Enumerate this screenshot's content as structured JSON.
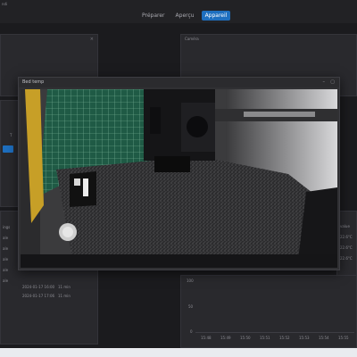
{
  "app": {
    "title": "ndi"
  },
  "nav": {
    "tabs": [
      {
        "label": "Préparer"
      },
      {
        "label": "Aperçu"
      },
      {
        "label": "Appareil"
      }
    ]
  },
  "left_panel": {
    "close": "×"
  },
  "right_panel": {
    "title": "Caméra"
  },
  "right_lower": {
    "values": [
      "value",
      "22.6°C",
      "22.6°C",
      "22.6°C"
    ]
  },
  "timeline": {
    "dates": [
      "2024-01-17 16:00",
      "2024-01-17 17:06"
    ],
    "times": [
      "11 min",
      "11 min"
    ],
    "left_labels": [
      "ings",
      "ale",
      "ale",
      "ale",
      "ale",
      "ale"
    ]
  },
  "chart": {
    "y_ticks": [
      "100",
      "50",
      "0"
    ],
    "x_ticks": [
      "15:48",
      "15:49",
      "15:50",
      "15:51",
      "15:52",
      "15:53",
      "15:54",
      "15:55"
    ]
  },
  "dialog": {
    "title": "Bed temp",
    "min": "–",
    "max": "▢"
  },
  "colors": {
    "accent": "#1e6fbf",
    "background": "#1b1b1e"
  }
}
